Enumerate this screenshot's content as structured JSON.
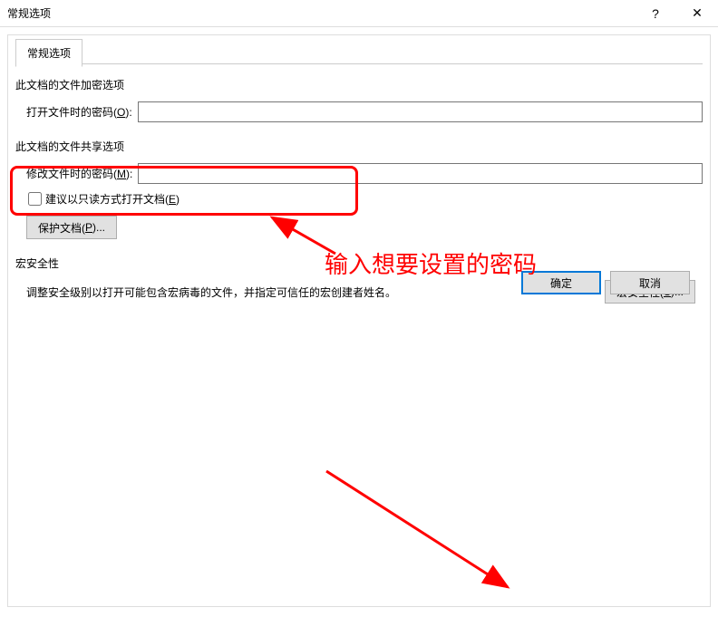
{
  "titlebar": {
    "title": "常规选项",
    "help": "?",
    "close": "✕"
  },
  "tabs": {
    "general": "常规选项"
  },
  "encrypt_section": {
    "label": "此文档的文件加密选项",
    "open_password_label": "打开文件时的密码(O):",
    "open_password_value": ""
  },
  "share_section": {
    "label": "此文档的文件共享选项",
    "modify_password_label": "修改文件时的密码(M):",
    "modify_password_value": "",
    "readonly_checkbox": "建议以只读方式打开文档(E)",
    "readonly_checked": false,
    "protect_button": "保护文档(P)..."
  },
  "macro_section": {
    "label": "宏安全性",
    "description": "调整安全级别以打开可能包含宏病毒的文件，并指定可信任的宏创建者姓名。",
    "button": "宏安全性(S)..."
  },
  "footer": {
    "ok": "确定",
    "cancel": "取消"
  },
  "annotation": {
    "text": "输入想要设置的密码"
  }
}
